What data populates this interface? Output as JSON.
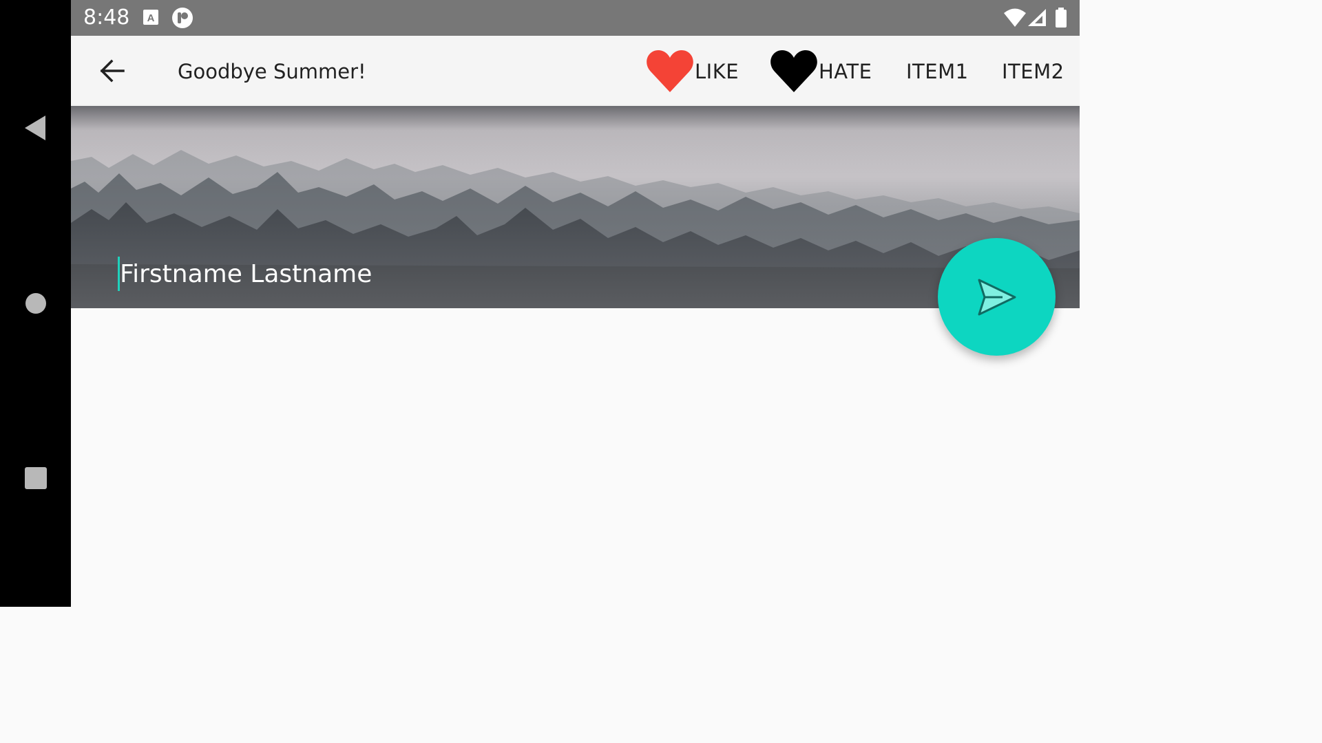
{
  "status_bar": {
    "time": "8:48",
    "icons": [
      "a-notification-icon",
      "circle-p-notification-icon",
      "wifi-icon",
      "cell-signal-icon",
      "battery-icon"
    ]
  },
  "nav_bar": {
    "buttons": [
      "back-triangle-icon",
      "home-circle-icon",
      "recents-square-icon"
    ]
  },
  "app_bar": {
    "back_icon": "arrow-left-icon",
    "title": "Goodbye Summer!",
    "actions": [
      {
        "label": "LIKE",
        "icon": "heart-icon",
        "icon_color": "#f44336"
      },
      {
        "label": "HATE",
        "icon": "heart-icon",
        "icon_color": "#000000"
      },
      {
        "label": "ITEM1"
      },
      {
        "label": "ITEM2"
      }
    ]
  },
  "header": {
    "image": "misty-forest-image",
    "name_field_value": "Firstname Lastname"
  },
  "fab": {
    "icon": "send-icon"
  },
  "colors": {
    "accent": "#0dd6c1",
    "cursor": "#1fd1bc",
    "like_heart": "#f44336",
    "hate_heart": "#000000",
    "status_bar": "#777777",
    "app_bar": "#f5f5f5"
  }
}
